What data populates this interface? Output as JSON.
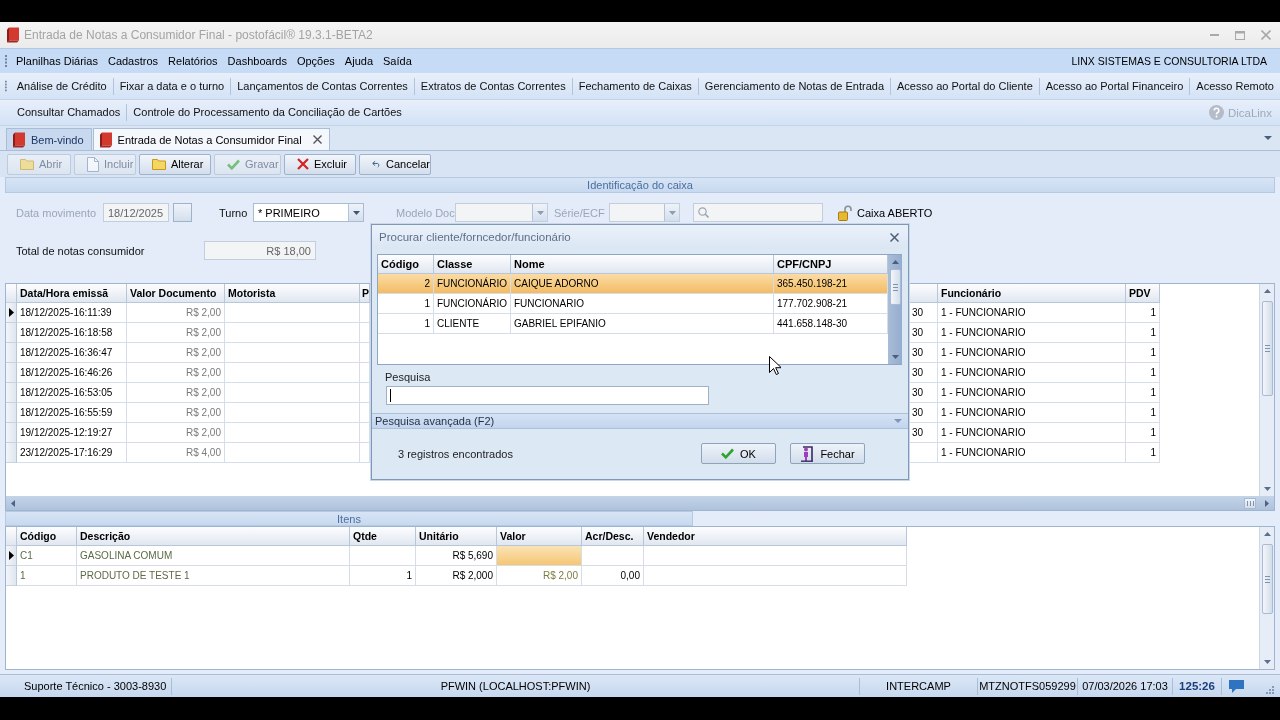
{
  "window": {
    "title": "Entrada de Notas a Consumidor Final - postofácil® 19.3.1-BETA2",
    "active": false
  },
  "menu": {
    "items": [
      "Planilhas Diárias",
      "Cadastros",
      "Relatórios",
      "Dashboards",
      "Opções",
      "Ajuda",
      "Saída"
    ],
    "company": "LINX SISTEMAS E CONSULTORIA LTDA"
  },
  "shortcuts_1": [
    "Análise de Crédito",
    "Fixar a data e o turno",
    "Lançamentos de Contas Correntes",
    "Extratos de Contas Correntes",
    "Fechamento de Caixas",
    "Gerenciamento de Notas de Entrada",
    "Acesso ao Portal do Cliente",
    "Acesso ao Portal Financeiro",
    "Acesso Remoto"
  ],
  "shortcuts_2": {
    "items": [
      "Consultar Chamados",
      "Controle do Processamento da Conciliação de Cartões"
    ],
    "help": {
      "label": "DicaLinx",
      "disabled": true
    }
  },
  "tabs": [
    {
      "label": "Bem-vindo",
      "selected": false,
      "closable": false
    },
    {
      "label": "Entrada de Notas a Consumidor Final",
      "selected": true,
      "closable": true
    }
  ],
  "actions": [
    {
      "label": "Abrir",
      "disabled": true
    },
    {
      "label": "Incluir",
      "disabled": true
    },
    {
      "label": "Alterar",
      "disabled": false
    },
    {
      "label": "Gravar",
      "disabled": true
    },
    {
      "label": "Excluir",
      "disabled": false
    },
    {
      "label": "Cancelar",
      "disabled": false
    }
  ],
  "identification": {
    "title": "Identificação do caixa",
    "data_movimento": {
      "label": "Data movimento",
      "value": "18/12/2025",
      "disabled": true
    },
    "turno": {
      "label": "Turno",
      "value": "* PRIMEIRO",
      "disabled": false
    },
    "modelo_doc": {
      "label": "Modelo Doc",
      "disabled": true
    },
    "serie_ecf": {
      "label": "Série/ECF",
      "disabled": true
    },
    "search": {
      "disabled": true
    },
    "caixa_status": "Caixa ABERTO",
    "total": {
      "label": "Total de notas consumidor",
      "value": "R$ 18,00"
    }
  },
  "main_grid": {
    "columns": [
      "Data/Hora emissã",
      "Valor Documento",
      "Motorista",
      "P",
      "Funcionário",
      "PDV"
    ],
    "rows": [
      {
        "selected": true,
        "data_hora": "18/12/2025-16:11:39",
        "valor": "R$ 2,00",
        "column_5": "30",
        "funcionario": "1 - FUNCIONARIO",
        "pdv": "1"
      },
      {
        "selected": false,
        "data_hora": "18/12/2025-16:18:58",
        "valor": "R$ 2,00",
        "column_5": "30",
        "funcionario": "1 - FUNCIONARIO",
        "pdv": "1"
      },
      {
        "selected": false,
        "data_hora": "18/12/2025-16:36:47",
        "valor": "R$ 2,00",
        "column_5": "30",
        "funcionario": "1 - FUNCIONARIO",
        "pdv": "1"
      },
      {
        "selected": false,
        "data_hora": "18/12/2025-16:46:26",
        "valor": "R$ 2,00",
        "column_5": "30",
        "funcionario": "1 - FUNCIONARIO",
        "pdv": "1"
      },
      {
        "selected": false,
        "data_hora": "18/12/2025-16:53:05",
        "valor": "R$ 2,00",
        "column_5": "30",
        "funcionario": "1 - FUNCIONARIO",
        "pdv": "1"
      },
      {
        "selected": false,
        "data_hora": "18/12/2025-16:55:59",
        "valor": "R$ 2,00",
        "column_5": "30",
        "funcionario": "1 - FUNCIONARIO",
        "pdv": "1"
      },
      {
        "selected": false,
        "data_hora": "19/12/2025-12:19:27",
        "valor": "R$ 2,00",
        "column_5": "30",
        "funcionario": "1 - FUNCIONARIO",
        "pdv": "1"
      },
      {
        "selected": false,
        "data_hora": "23/12/2025-17:16:29",
        "valor": "R$ 4,00",
        "funcionario": "1 - FUNCIONARIO",
        "pdv": "1"
      }
    ]
  },
  "items": {
    "title": "Itens",
    "columns": [
      "Código",
      "Descrição",
      "Qtde",
      "Unitário",
      "Valor",
      "Acr/Desc.",
      "Vendedor"
    ],
    "rows": [
      {
        "selected": true,
        "codigo": "C1",
        "descricao": "GASOLINA COMUM",
        "unitario": "R$ 5,690",
        "valor_focused": true
      },
      {
        "selected": false,
        "codigo": "1",
        "descricao": "PRODUTO DE TESTE 1",
        "qtde": "1",
        "unitario": "R$ 2,000",
        "valor": "R$ 2,00",
        "acr_desc": "0,00",
        "valor_focused": false
      }
    ]
  },
  "search_dialog": {
    "title": "Procurar cliente/forncedor/funcionário",
    "columns": [
      "Código",
      "Classe",
      "Nome",
      "CPF/CNPJ"
    ],
    "rows": [
      {
        "selected": true,
        "codigo": "2",
        "classe": "FUNCIONÁRIO",
        "nome": "CAIQUE ADORNO",
        "cpf_cnpj": "365.450.198-21"
      },
      {
        "selected": false,
        "codigo": "1",
        "classe": "FUNCIONÁRIO",
        "nome": "FUNCIONARIO",
        "cpf_cnpj": "177.702.908-21"
      },
      {
        "selected": false,
        "codigo": "1",
        "classe": "CLIENTE",
        "nome": "GABRIEL EPIFANIO",
        "cpf_cnpj": "441.658.148-30"
      }
    ],
    "search_label": "Pesquisa",
    "advanced": {
      "label": "Pesquisa avançada (F2)",
      "expanded": false
    },
    "result_count": "3 registros encontrados",
    "buttons": [
      "OK",
      "Fechar"
    ]
  },
  "status_bar": {
    "support": "Suporte Técnico - 3003-8930",
    "database": "PFWIN (LOCALHOST:PFWIN)",
    "company": "INTERCAMP",
    "machine": "MTZNOTFS059299",
    "datetime": "07/03/2026 17:03",
    "timer": "125:26"
  }
}
